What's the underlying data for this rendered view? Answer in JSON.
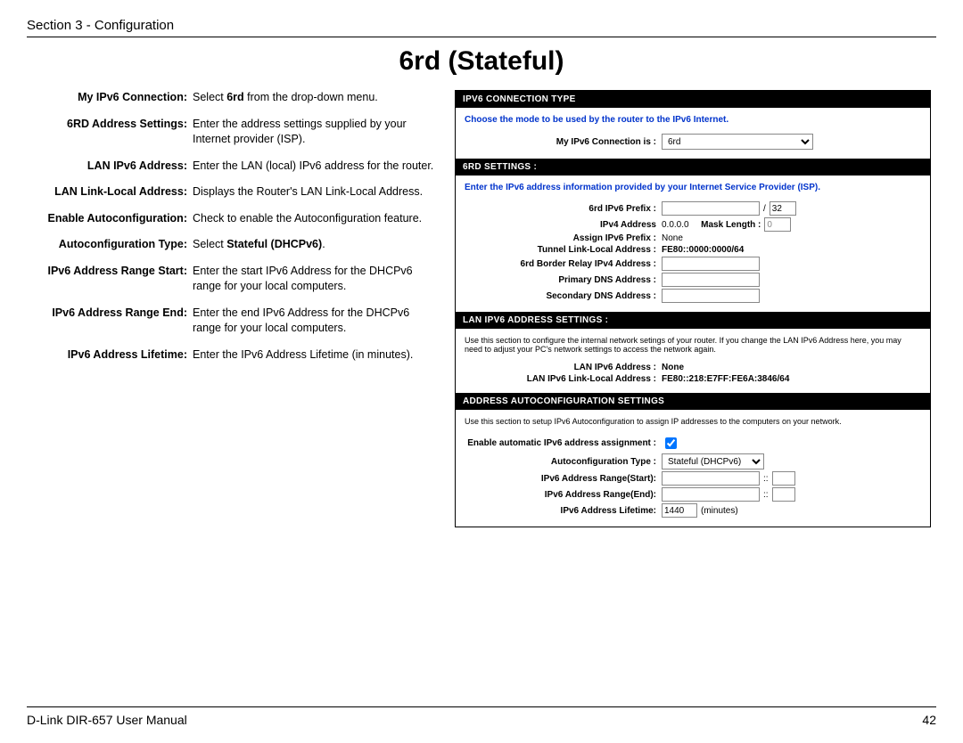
{
  "header": {
    "section": "Section 3 - Configuration",
    "title": "6rd (Stateful)"
  },
  "defs": [
    {
      "label": "My IPv6 Connection:",
      "text_before": "Select ",
      "bold": "6rd",
      "text_after": " from the drop-down menu."
    },
    {
      "label": "6RD Address Settings:",
      "text_before": "Enter the address settings supplied by your Internet provider (ISP).",
      "bold": "",
      "text_after": ""
    },
    {
      "label": "LAN IPv6 Address:",
      "text_before": "Enter the LAN (local) IPv6 address for the router.",
      "bold": "",
      "text_after": ""
    },
    {
      "label": "LAN Link-Local Address:",
      "text_before": "Displays the Router's LAN Link-Local Address.",
      "bold": "",
      "text_after": ""
    },
    {
      "label": "Enable Autoconfiguration:",
      "text_before": "Check to enable the Autoconfiguration feature.",
      "bold": "",
      "text_after": ""
    },
    {
      "label": "Autoconfiguration Type:",
      "text_before": "Select ",
      "bold": "Stateful (DHCPv6)",
      "text_after": "."
    },
    {
      "label": "IPv6 Address Range Start:",
      "text_before": "Enter the start IPv6 Address for the DHCPv6 range for your local computers.",
      "bold": "",
      "text_after": ""
    },
    {
      "label": "IPv6 Address Range End:",
      "text_before": "Enter the end IPv6 Address for the DHCPv6 range for your local computers.",
      "bold": "",
      "text_after": ""
    },
    {
      "label": "IPv6 Address Lifetime:",
      "text_before": "Enter the IPv6 Address Lifetime (in minutes).",
      "bold": "",
      "text_after": ""
    }
  ],
  "panel": {
    "conn_type": {
      "header": "IPv6 CONNECTION TYPE",
      "desc": "Choose the mode to be used by the router to the IPv6 Internet.",
      "label": "My IPv6 Connection is :",
      "value": "6rd"
    },
    "sixrd": {
      "header": "6RD SETTINGS :",
      "desc": "Enter the IPv6 address information provided by your Internet Service Provider (ISP).",
      "prefix_label": "6rd IPv6 Prefix :",
      "prefix_value": "",
      "prefix_len": "32",
      "ipv4_label": "IPv4 Address",
      "ipv4_value": "0.0.0.0",
      "mask_label": "Mask Length :",
      "mask_value": "0",
      "assign_label": "Assign IPv6 Prefix :",
      "assign_value": "None",
      "tunnel_label": "Tunnel Link-Local Address :",
      "tunnel_value": "FE80::0000:0000/64",
      "relay_label": "6rd Border Relay IPv4 Address :",
      "relay_value": "",
      "dns1_label": "Primary DNS Address :",
      "dns1_value": "",
      "dns2_label": "Secondary DNS Address :",
      "dns2_value": ""
    },
    "lan": {
      "header": "LAN IPv6 ADDRESS SETTINGS :",
      "note": "Use this section to configure the internal network setings of your router. If you change the LAN IPv6 Address here, you may need to adjust your PC's network settings to access the network again.",
      "addr_label": "LAN IPv6 Address :",
      "addr_value": "None",
      "ll_label": "LAN IPv6 Link-Local Address :",
      "ll_value": "FE80::218:E7FF:FE6A:3846/64"
    },
    "auto": {
      "header": "ADDRESS AUTOCONFIGURATION SETTINGS",
      "note": "Use this section to setup IPv6 Autoconfiguration to assign IP addresses to the computers on your network.",
      "enable_label": "Enable automatic IPv6 address assignment :",
      "type_label": "Autoconfiguration Type :",
      "type_value": "Stateful (DHCPv6)",
      "start_label": "IPv6 Address Range(Start):",
      "end_label": "IPv6 Address Range(End):",
      "sep": "::",
      "life_label": "IPv6 Address Lifetime:",
      "life_value": "1440",
      "life_unit": "(minutes)"
    }
  },
  "footer": {
    "left": "D-Link DIR-657 User Manual",
    "right": "42"
  }
}
